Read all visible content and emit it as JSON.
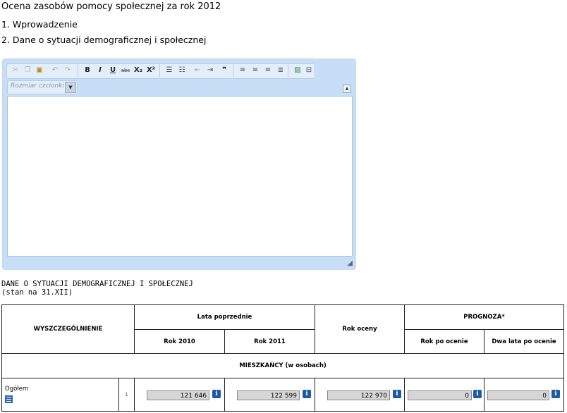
{
  "page": {
    "title": "Ocena zasobów pomocy społecznej za rok 2012",
    "sections": [
      "1. Wprowadzenie",
      "2. Dane o sytuacji demograficznej i społecznej"
    ]
  },
  "editor": {
    "font_size_placeholder": "Rozmiar czcionki",
    "toolbar": {
      "bold": "B",
      "italic": "I",
      "underline": "U",
      "strike": "abc",
      "subscript": "X₂",
      "superscript": "X²",
      "quote": "❞"
    }
  },
  "section_header": {
    "line1": "DANE O SYTUACJI DEMOGRAFICZNEJ I SPOŁECZNEJ",
    "line2": "(stan na 31.XII)"
  },
  "table": {
    "col_main": "WYSZCZEGÓLNIENIE",
    "group_prev": "Lata poprzednie",
    "year_2010": "Rok 2010",
    "year_2011": "Rok 2011",
    "rok_oceny": "Rok oceny",
    "prognoza": "PROGNOZA*",
    "rok_po": "Rok po ocenie",
    "dwa_lata": "Dwa lata po ocenie",
    "group_row": "MIESZKAŃCY (w osobach)",
    "rows": [
      {
        "label": "Ogółem",
        "lp": "1",
        "v2010": "121 646",
        "v2011": "122 599",
        "vocena": "122 970",
        "vrokpo": "0",
        "vdwa": "0"
      }
    ],
    "info_glyph": "i"
  }
}
